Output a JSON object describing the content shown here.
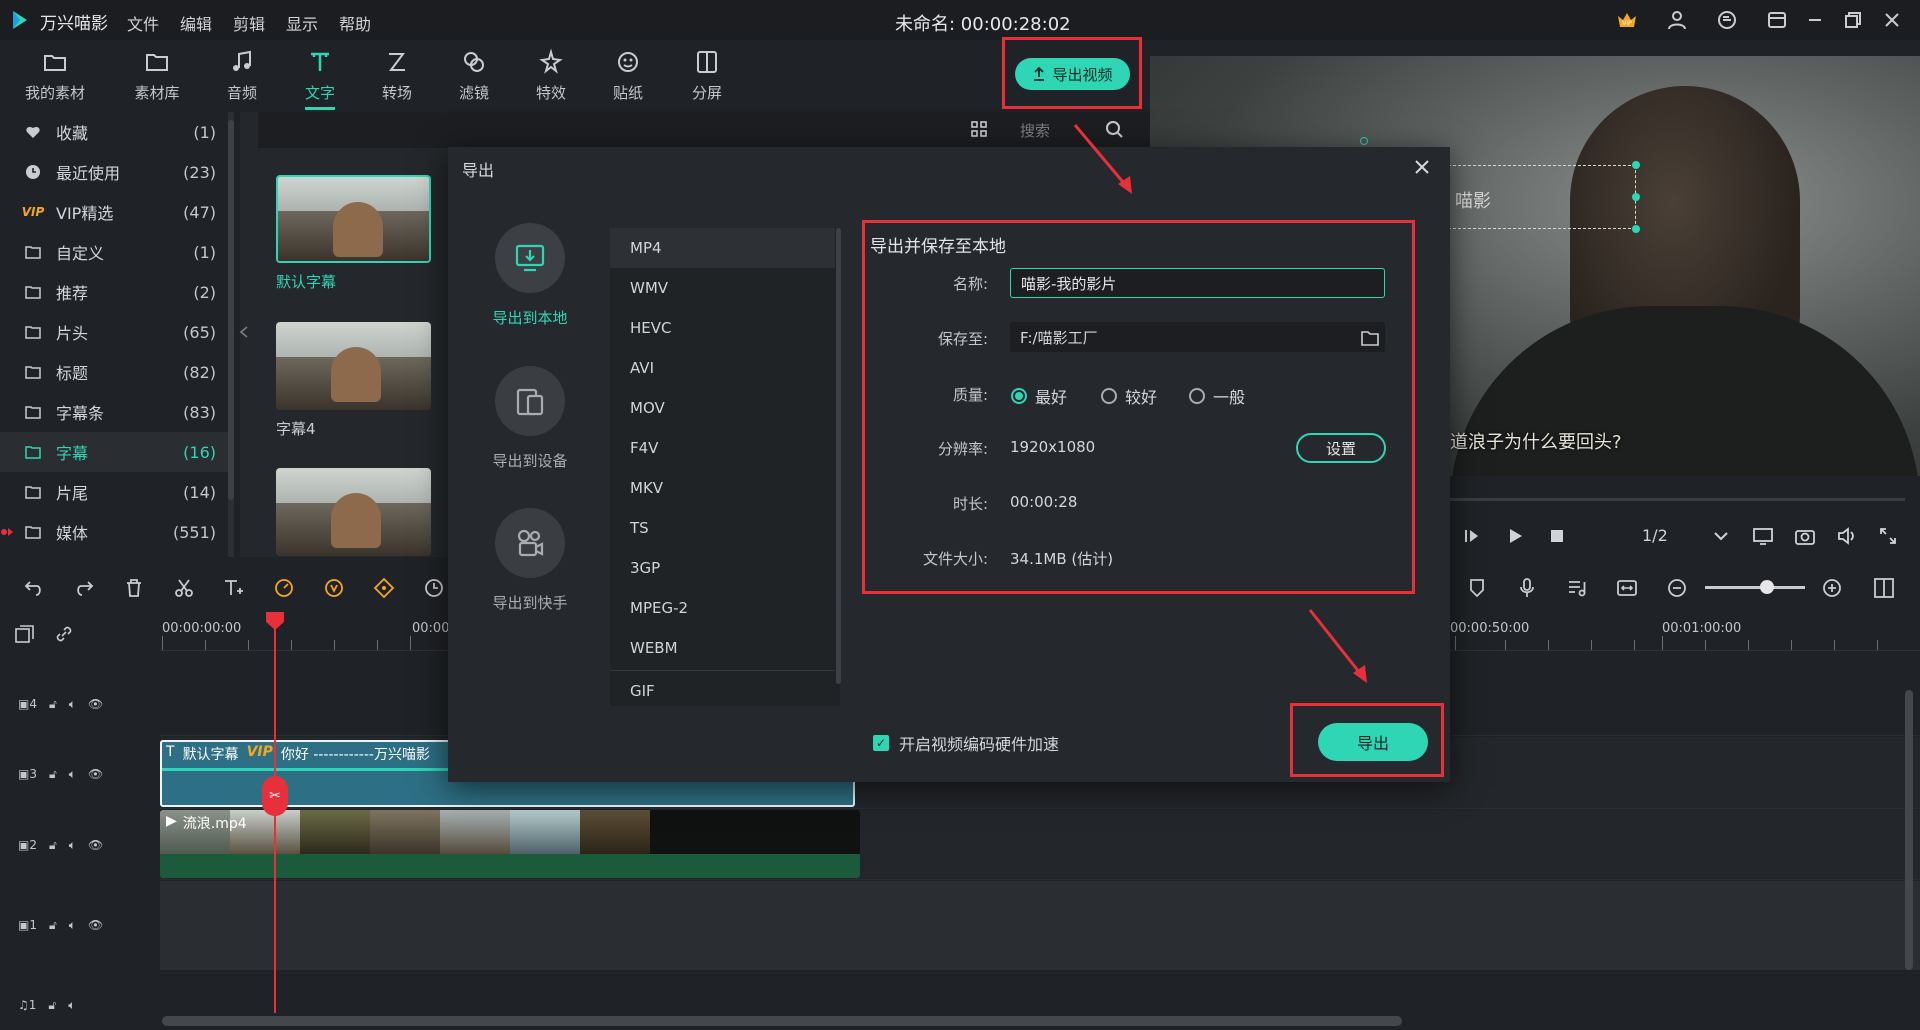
{
  "app": {
    "name": "万兴喵影",
    "title": "未命名: 00:00:28:02"
  },
  "menu": [
    "文件",
    "编辑",
    "剪辑",
    "显示",
    "帮助"
  ],
  "toolbar": [
    {
      "label": "我的素材",
      "icon": "folder-open-icon"
    },
    {
      "label": "素材库",
      "icon": "folder-icon"
    },
    {
      "label": "音频",
      "icon": "music-note-icon"
    },
    {
      "label": "文字",
      "icon": "text-icon",
      "active": true
    },
    {
      "label": "转场",
      "icon": "transition-icon"
    },
    {
      "label": "滤镜",
      "icon": "filter-icon"
    },
    {
      "label": "特效",
      "icon": "effects-icon"
    },
    {
      "label": "贴纸",
      "icon": "sticker-icon"
    },
    {
      "label": "分屏",
      "icon": "split-screen-icon"
    }
  ],
  "export_video_label": "导出视频",
  "sidebar": [
    {
      "label": "收藏",
      "count": "(1)",
      "icon": "heart-icon"
    },
    {
      "label": "最近使用",
      "count": "(23)",
      "icon": "clock-icon"
    },
    {
      "label": "VIP精选",
      "count": "(47)",
      "icon": "vip-icon",
      "badge": "VIP"
    },
    {
      "label": "自定义",
      "count": "(1)",
      "icon": "folder-icon"
    },
    {
      "label": "推荐",
      "count": "(2)",
      "icon": "folder-icon"
    },
    {
      "label": "片头",
      "count": "(65)",
      "icon": "folder-icon"
    },
    {
      "label": "标题",
      "count": "(82)",
      "icon": "folder-icon"
    },
    {
      "label": "字幕条",
      "count": "(83)",
      "icon": "folder-icon"
    },
    {
      "label": "字幕",
      "count": "(16)",
      "icon": "folder-icon",
      "active": true
    },
    {
      "label": "片尾",
      "count": "(14)",
      "icon": "folder-icon"
    },
    {
      "label": "媒体",
      "count": "(551)",
      "icon": "folder-icon"
    }
  ],
  "search": {
    "placeholder": "搜索"
  },
  "thumbnails": [
    {
      "label": "默认字幕",
      "selected": true
    },
    {
      "label": "字幕4"
    },
    {
      "label": ""
    }
  ],
  "preview": {
    "title_text": "喵影",
    "subtitle": "道浪子为什么要回头?",
    "ratio": "1/2"
  },
  "timeline": {
    "ruler": [
      "00:00:00:00",
      "00:00",
      "00:00:50:00",
      "00:01:00:00"
    ],
    "tracks": [
      "4",
      "3",
      "2",
      "1",
      "1"
    ],
    "text_clip": {
      "name": "默认字幕",
      "badge": "VIP",
      "text": "你好 ------------万兴喵影"
    },
    "video_clip": {
      "name": "流浪.mp4"
    }
  },
  "dialog": {
    "title": "导出",
    "destinations": [
      {
        "label": "导出到本地",
        "icon": "export-local-icon",
        "active": true
      },
      {
        "label": "导出到设备",
        "icon": "device-icon"
      },
      {
        "label": "导出到快手",
        "icon": "kuaishou-icon"
      }
    ],
    "formats": [
      "MP4",
      "WMV",
      "HEVC",
      "AVI",
      "MOV",
      "F4V",
      "MKV",
      "TS",
      "3GP",
      "MPEG-2",
      "WEBM",
      "GIF"
    ],
    "selected_format": "MP4",
    "settings": {
      "title": "导出并保存至本地",
      "name_label": "名称:",
      "name_value": "喵影-我的影片",
      "save_label": "保存至:",
      "save_path": "F:/喵影工厂",
      "quality_label": "质量:",
      "quality_options": [
        "最好",
        "较好",
        "一般"
      ],
      "quality_selected": "最好",
      "resolution_label": "分辨率:",
      "resolution_value": "1920x1080",
      "setup_label": "设置",
      "duration_label": "时长:",
      "duration_value": "00:00:28",
      "size_label": "文件大小:",
      "size_value": "34.1MB (估计)"
    },
    "hw_accel_label": "开启视频编码硬件加速",
    "hw_accel_checked": true,
    "export_label": "导出"
  },
  "colors": {
    "accent": "#2fd6b5",
    "highlight": "#e8303a",
    "background": "#1f2226"
  }
}
